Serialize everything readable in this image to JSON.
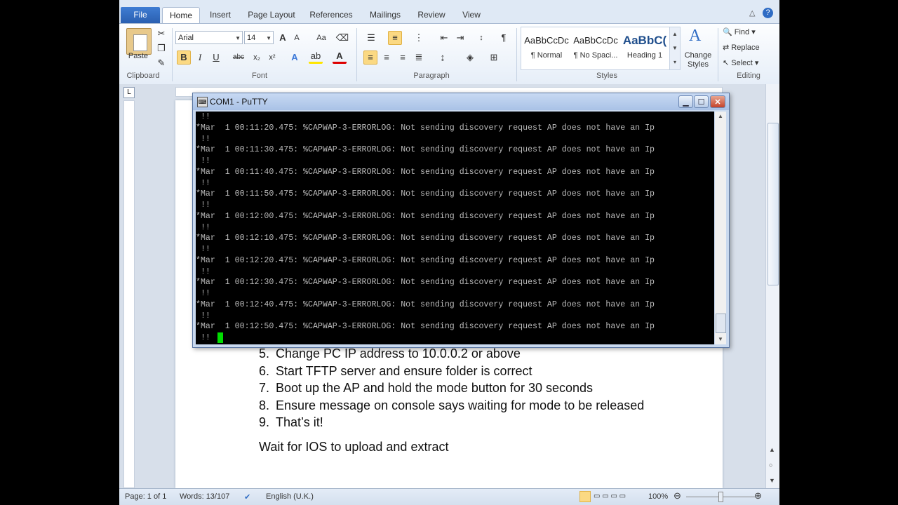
{
  "ribbon": {
    "tabs": [
      "File",
      "Home",
      "Insert",
      "Page Layout",
      "References",
      "Mailings",
      "Review",
      "View"
    ],
    "font_name": "Arial",
    "font_size": "14",
    "paste_label": "Paste",
    "clipboard_label": "Clipboard",
    "font_label": "Font",
    "paragraph_label": "Paragraph",
    "styles_label": "Styles",
    "editing_label": "Editing",
    "styles": [
      {
        "sample": "AaBbCcDc",
        "name": "¶ Normal"
      },
      {
        "sample": "AaBbCcDc",
        "name": "¶ No Spaci..."
      },
      {
        "sample": "AaBbC(",
        "name": "Heading 1"
      }
    ],
    "change_styles_line1": "Change",
    "change_styles_line2": "Styles",
    "find_label": "Find",
    "replace_label": "Replace",
    "select_label": "Select"
  },
  "putty": {
    "title": "COM1 - PuTTY",
    "log_lines": [
      " !!",
      "*Mar  1 00:11:20.475: %CAPWAP-3-ERRORLOG: Not sending discovery request AP does not have an Ip",
      " !!",
      "*Mar  1 00:11:30.475: %CAPWAP-3-ERRORLOG: Not sending discovery request AP does not have an Ip",
      " !!",
      "*Mar  1 00:11:40.475: %CAPWAP-3-ERRORLOG: Not sending discovery request AP does not have an Ip",
      " !!",
      "*Mar  1 00:11:50.475: %CAPWAP-3-ERRORLOG: Not sending discovery request AP does not have an Ip",
      " !!",
      "*Mar  1 00:12:00.475: %CAPWAP-3-ERRORLOG: Not sending discovery request AP does not have an Ip",
      " !!",
      "*Mar  1 00:12:10.475: %CAPWAP-3-ERRORLOG: Not sending discovery request AP does not have an Ip",
      " !!",
      "*Mar  1 00:12:20.475: %CAPWAP-3-ERRORLOG: Not sending discovery request AP does not have an Ip",
      " !!",
      "*Mar  1 00:12:30.475: %CAPWAP-3-ERRORLOG: Not sending discovery request AP does not have an Ip",
      " !!",
      "*Mar  1 00:12:40.475: %CAPWAP-3-ERRORLOG: Not sending discovery request AP does not have an Ip",
      " !!",
      "*Mar  1 00:12:50.475: %CAPWAP-3-ERRORLOG: Not sending discovery request AP does not have an Ip",
      " !!"
    ]
  },
  "document": {
    "steps": [
      {
        "num": "5.",
        "text": "Change PC IP address to 10.0.0.2 or above"
      },
      {
        "num": "6.",
        "text": "Start TFTP server and ensure folder is correct"
      },
      {
        "num": "7.",
        "text": "Boot up the AP and hold the mode button for 30 seconds"
      },
      {
        "num": "8.",
        "text": "Ensure message on console says waiting for mode to be released"
      },
      {
        "num": "9.",
        "text": "That’s it!"
      }
    ],
    "footer_paragraph": "Wait for IOS to upload and extract"
  },
  "status": {
    "page": "Page: 1 of 1",
    "words": "Words: 13/107",
    "language": "English (U.K.)",
    "zoom": "100%"
  }
}
